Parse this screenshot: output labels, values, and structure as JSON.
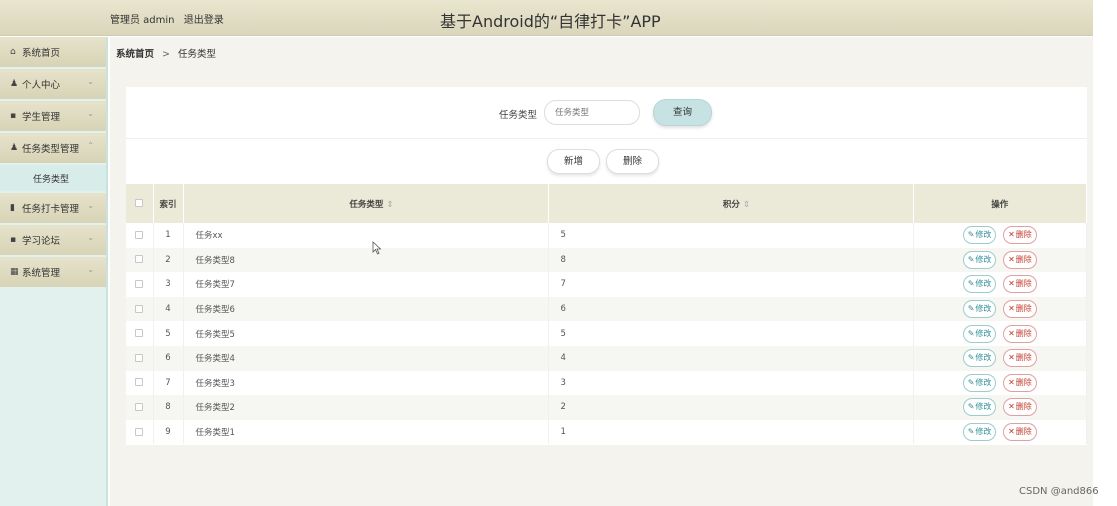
{
  "header": {
    "user_label": "管理员 admin",
    "logout_label": "退出登录",
    "app_title": "基于Android的“自律打卡”APP"
  },
  "sidebar": {
    "items": [
      {
        "label": "系统首页",
        "icon": "home-icon"
      },
      {
        "label": "个人中心",
        "icon": "user-icon"
      },
      {
        "label": "学生管理",
        "icon": "grid-icon"
      },
      {
        "label": "任务类型管理",
        "icon": "user-icon"
      },
      {
        "label": "任务打卡管理",
        "icon": "clipboard-icon"
      },
      {
        "label": "学习论坛",
        "icon": "grid-icon"
      },
      {
        "label": "系统管理",
        "icon": "table-icon"
      }
    ],
    "subitem": "任务类型"
  },
  "breadcrumb": {
    "home": "系统首页",
    "separator": ">",
    "current": "任务类型"
  },
  "search": {
    "label": "任务类型",
    "placeholder": "任务类型",
    "button": "查询"
  },
  "actions": {
    "add": "新增",
    "delete": "删除"
  },
  "table": {
    "columns": {
      "index": "索引",
      "name": "任务类型",
      "score": "积分",
      "ops": "操作"
    },
    "edit_label": "修改",
    "delete_label": "删除",
    "rows": [
      {
        "index": "1",
        "name": "任务xx",
        "score": "5"
      },
      {
        "index": "2",
        "name": "任务类型8",
        "score": "8"
      },
      {
        "index": "3",
        "name": "任务类型7",
        "score": "7"
      },
      {
        "index": "4",
        "name": "任务类型6",
        "score": "6"
      },
      {
        "index": "5",
        "name": "任务类型5",
        "score": "5"
      },
      {
        "index": "6",
        "name": "任务类型4",
        "score": "4"
      },
      {
        "index": "7",
        "name": "任务类型3",
        "score": "3"
      },
      {
        "index": "8",
        "name": "任务类型2",
        "score": "2"
      },
      {
        "index": "9",
        "name": "任务类型1",
        "score": "1"
      }
    ]
  },
  "watermark": "CSDN @and866",
  "colors": {
    "header_bg": "#e2dfc5",
    "sidebar_bg": "#e3f1ee",
    "accent": "#c6e2e2",
    "danger": "#c0392b"
  }
}
